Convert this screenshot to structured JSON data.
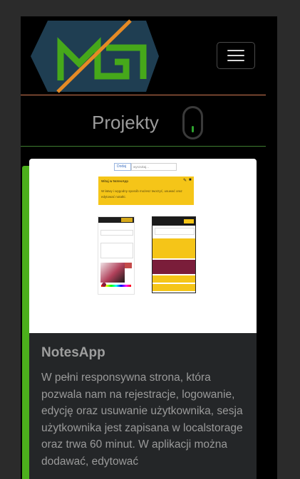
{
  "navbar": {
    "logo_alt": "MG",
    "colors": {
      "logo_shape": "#1f3e52",
      "logo_letters": "#46a81a",
      "logo_slash": "#e58a25"
    }
  },
  "section": {
    "title": "Projekty"
  },
  "card": {
    "image": {
      "search_button": "Dodaj",
      "search_placeholder": "wyszukaj...",
      "note_title": "Witaj w NotesApp",
      "note_text": "W łatwy i wygodny sposób możesz tworzyć, usuwać oraz edytować notatki."
    },
    "title": "NotesApp",
    "text": "W pełni responsywna strona, która pozwala nam na rejestracje, logowanie, edycję oraz usuwanie użytkownika, sesja użytkownika jest zapisana w localstorage oraz trwa 60 minut. W aplikacji można dodawać, edytować"
  },
  "colors": {
    "accent_green": "#4caf1c",
    "divider_orange": "#d27a53",
    "divider_green": "#3e7d30"
  }
}
